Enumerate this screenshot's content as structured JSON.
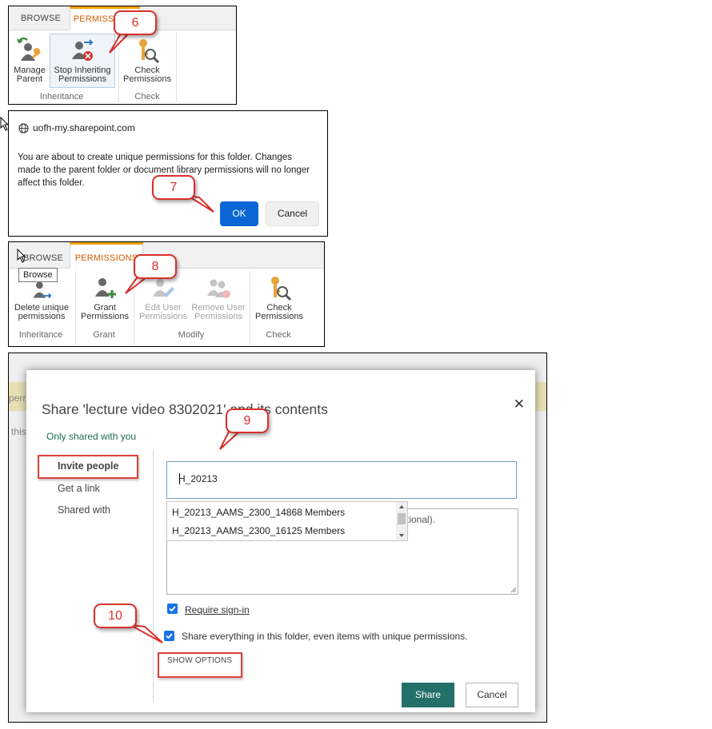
{
  "panel1": {
    "tabs": [
      "BROWSE",
      "PERMISSIONS"
    ],
    "buttons": [
      {
        "line1": "Manage",
        "line2": "Parent",
        "icon": "manage-parent-icon"
      },
      {
        "line1": "Stop Inheriting",
        "line2": "Permissions",
        "icon": "stop-inheriting-icon"
      },
      {
        "line1": "Check",
        "line2": "Permissions",
        "icon": "check-permissions-icon"
      }
    ],
    "groups": [
      "Inheritance",
      "Check"
    ],
    "callout": "6"
  },
  "panel2": {
    "site": "uofh-my.sharepoint.com",
    "message": "You are about to create unique permissions for this folder. Changes made to the parent folder or document library permissions will no longer affect this folder.",
    "ok_label": "OK",
    "cancel_label": "Cancel",
    "callout": "7"
  },
  "panel3": {
    "tabs": [
      "BROWSE",
      "PERMISSIONS"
    ],
    "tooltip": "Browse",
    "buttons": [
      {
        "line1": "Delete unique",
        "line2": "permissions",
        "icon": "delete-unique-icon",
        "enabled": true
      },
      {
        "line1": "Grant",
        "line2": "Permissions",
        "icon": "grant-permissions-icon",
        "enabled": true
      },
      {
        "line1": "Edit User",
        "line2": "Permissions",
        "icon": "edit-user-icon",
        "enabled": false
      },
      {
        "line1": "Remove User",
        "line2": "Permissions",
        "icon": "remove-user-icon",
        "enabled": false
      },
      {
        "line1": "Check",
        "line2": "Permissions",
        "icon": "check-permissions-icon",
        "enabled": true
      }
    ],
    "groups": [
      "Inheritance",
      "Grant",
      "Modify",
      "Check"
    ],
    "callout": "8"
  },
  "panel4": {
    "background_fragments": [
      "perr",
      "this"
    ],
    "title": "Share 'lecture video 8302021' and its contents",
    "close": "✕",
    "shared_status": "Only shared with you",
    "nav": [
      "Invite people",
      "Get a link",
      "Shared with"
    ],
    "input_value": "H_20213",
    "suggestions": [
      "H_20213_AAMS_2300_14868 Members",
      "H_20213_AAMS_2300_16125 Members"
    ],
    "message_placeholder_tail": "tional).",
    "require_signin": "Require sign-in",
    "share_everything": "Share everything in this folder, even items with unique permissions.",
    "show_options": "SHOW OPTIONS",
    "share_label": "Share",
    "cancel_label": "Cancel",
    "callouts": [
      "9",
      "10"
    ]
  },
  "colors": {
    "accent_blue": "#0a66d6",
    "share_green": "#23706b",
    "callout_red": "#d9302c",
    "ribbon_orange": "#f2a100"
  }
}
